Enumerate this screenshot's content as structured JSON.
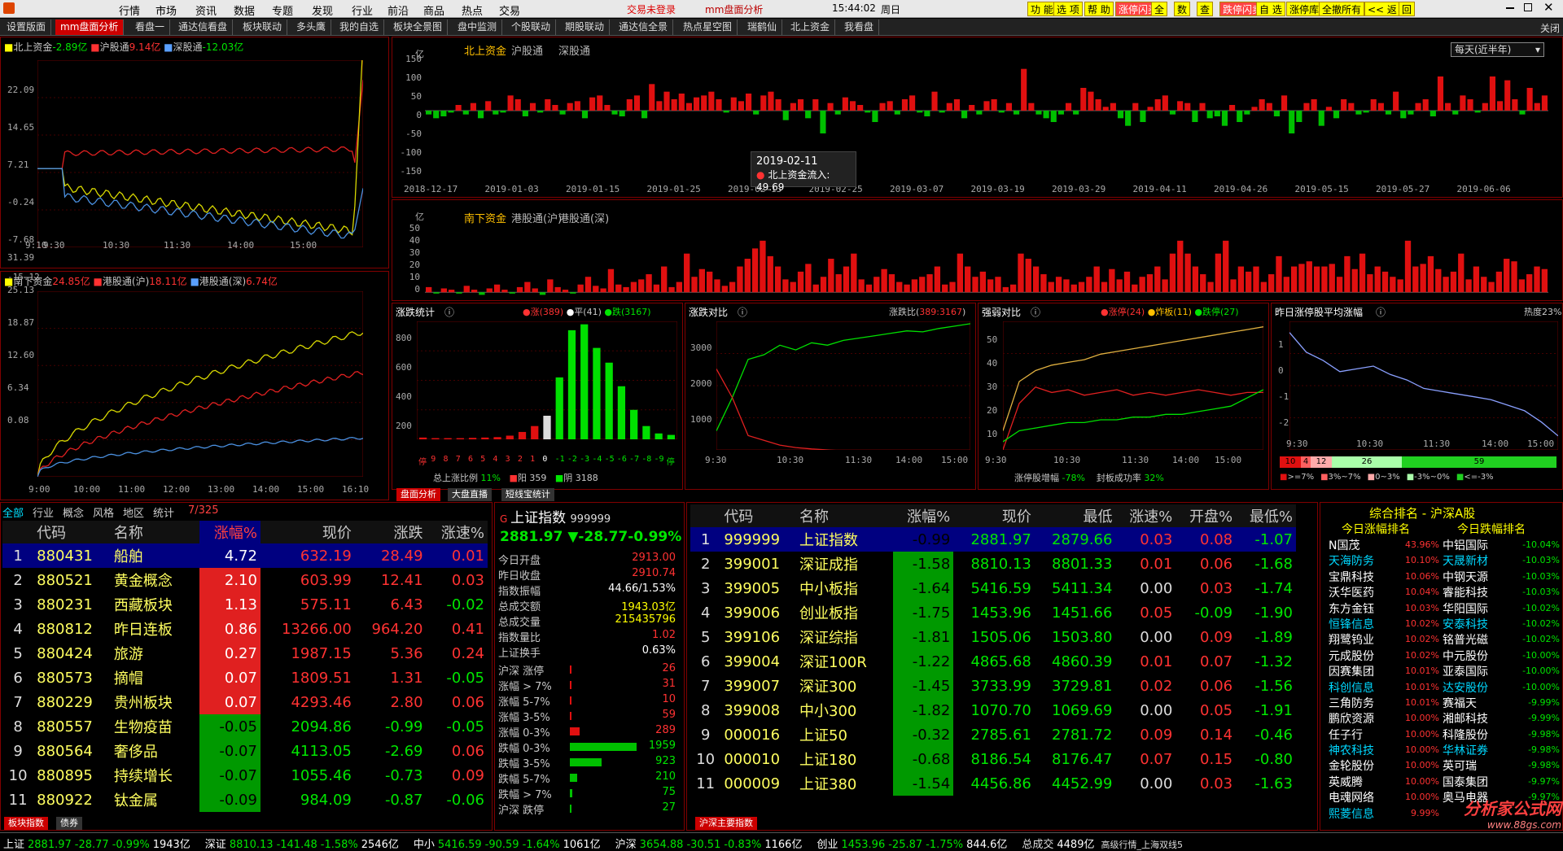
{
  "menu": {
    "items": [
      "行情",
      "市场",
      "资讯",
      "数据",
      "专题",
      "发现",
      "行业",
      "前沿",
      "商品",
      "热点",
      "交易"
    ],
    "login": "交易未登录",
    "title": "mm盘面分析",
    "quick": [
      "功 能",
      "选 项",
      "帮 助",
      "涨停闪买",
      "全",
      "数",
      "查",
      "跌停闪卖",
      "自 选",
      "涨停库",
      "全撤所有",
      "<< 返",
      "回"
    ],
    "time": "15:44:02",
    "weekday": "周日"
  },
  "tabs": [
    "设置版面",
    "mm盘面分析",
    "看盘一",
    "通达信看盘",
    "板块联动",
    "多头鹰",
    "我的自选",
    "板块全景图",
    "盘中监测",
    "个股联动",
    "期股联动",
    "通达信全景",
    "热点星空图",
    "瑞鹤仙",
    "北上资金",
    "我看盘"
  ],
  "close": "关闭",
  "north": {
    "l1": "北上资金",
    "v1": "-2.89亿",
    "l2": "沪股通",
    "v2": "9.14亿",
    "l3": "深股通",
    "v3": "-12.03亿",
    "yticks": [
      "22.09",
      "14.65",
      "7.21",
      "-0.24",
      "-7.68",
      "-15.12"
    ],
    "xticks": [
      "9:10",
      "9:30",
      "10:30",
      "11:30",
      "14:00",
      "15:00"
    ]
  },
  "south": {
    "l1": "南下资金",
    "v1": "24.85亿",
    "l2": "港股通(沪)",
    "v2": "18.11亿",
    "l3": "港股通(深)",
    "v3": "6.74亿",
    "yticks": [
      "31.39",
      "25.13",
      "18.87",
      "12.60",
      "6.34",
      "0.08"
    ],
    "xticks": [
      "9:00",
      "10:00",
      "11:00",
      "12:00",
      "13:00",
      "14:00",
      "15:00",
      "16:10"
    ]
  },
  "flowTop": {
    "unit": "亿",
    "tabs": [
      "北上资金",
      "沪股通",
      "深股通"
    ],
    "period": "每天(近半年)",
    "yticks": [
      "150",
      "100",
      "50",
      "0",
      "-50",
      "-100",
      "-150"
    ],
    "xticks": [
      "2018-12-17",
      "2019-01-03",
      "2019-01-15",
      "2019-01-25",
      "2019-02-13",
      "2019-02-25",
      "2019-03-07",
      "2019-03-19",
      "2019-03-29",
      "2019-04-11",
      "2019-04-26",
      "2019-05-15",
      "2019-05-27",
      "2019-06-06"
    ],
    "tipDate": "2019-02-11",
    "tipLabel": "北上资金流入: 49.69"
  },
  "flowBot": {
    "unit": "亿",
    "tabs": [
      "南下资金",
      "港股通(沪)",
      "港股通(深)"
    ],
    "yticks": [
      "50",
      "40",
      "30",
      "20",
      "10",
      "0"
    ]
  },
  "chart_data": [
    {
      "type": "bar",
      "title": "北上资金",
      "ylim": [
        -150,
        150
      ],
      "values": [
        -10,
        -20,
        -15,
        -5,
        15,
        -10,
        20,
        -20,
        25,
        -10,
        -5,
        40,
        30,
        -15,
        20,
        -5,
        30,
        15,
        -10,
        20,
        25,
        -20,
        35,
        40,
        15,
        -10,
        -15,
        30,
        40,
        -20,
        70,
        25,
        50,
        30,
        45,
        20,
        35,
        40,
        50,
        30,
        -5,
        35,
        25,
        45,
        -10,
        40,
        50,
        30,
        -25,
        20,
        30,
        -20,
        30,
        -60,
        20,
        -10,
        35,
        25,
        15,
        -5,
        -30,
        20,
        25,
        -10,
        30,
        40,
        -5,
        -15,
        50,
        -5,
        20,
        30,
        -20,
        15,
        -10,
        25,
        30,
        -5,
        20,
        -10,
        110,
        20,
        -10,
        -20,
        -30,
        -10,
        20,
        -10,
        60,
        50,
        30,
        10,
        20,
        -20,
        -40,
        20,
        -30,
        10,
        30,
        40,
        -10,
        25,
        20,
        -30,
        20,
        -20,
        -15,
        -40,
        15,
        -30,
        -10,
        10,
        30,
        20,
        -15,
        40,
        -60,
        -30,
        20,
        30,
        -40,
        10,
        -20,
        30,
        20,
        -10,
        -5,
        30,
        20,
        -10,
        50,
        -20,
        -10,
        20,
        30,
        -15,
        90,
        20,
        -10,
        40,
        30,
        -5,
        20,
        90,
        25,
        80,
        30,
        -10,
        60,
        20,
        40
      ]
    },
    {
      "type": "bar",
      "title": "南下资金",
      "ylim": [
        -5,
        50
      ],
      "values": [
        4,
        -1,
        3,
        2,
        -1,
        5,
        2,
        -2,
        3,
        6,
        2,
        -1,
        4,
        8,
        3,
        -2,
        10,
        4,
        2,
        -1,
        6,
        12,
        5,
        3,
        18,
        6,
        4,
        8,
        10,
        14,
        6,
        20,
        4,
        8,
        30,
        12,
        18,
        16,
        10,
        5,
        8,
        20,
        26,
        34,
        40,
        28,
        20,
        10,
        8,
        16,
        22,
        6,
        12,
        26,
        14,
        20,
        30,
        10,
        6,
        12,
        18,
        14,
        8,
        6,
        10,
        12,
        14,
        20,
        6,
        8,
        30,
        20,
        12,
        16,
        10,
        12,
        4,
        6,
        30,
        26,
        20,
        14,
        8,
        12,
        10,
        6,
        8,
        12,
        20,
        8,
        18,
        10,
        16,
        6,
        12,
        14,
        20,
        10,
        30,
        40,
        30,
        20,
        14,
        8,
        30,
        40,
        10,
        20,
        16,
        20,
        8,
        14,
        28,
        12,
        20,
        22,
        24,
        20,
        20,
        22,
        12,
        28,
        18,
        30,
        14,
        20,
        16,
        12,
        10,
        40,
        20,
        22,
        28,
        18,
        12,
        16,
        30,
        10,
        20,
        12,
        8,
        16,
        26,
        24,
        10,
        14,
        20,
        18
      ]
    },
    {
      "type": "bar",
      "title": "涨跌统计",
      "categories": [
        "停",
        "9",
        "8",
        "7",
        "6",
        "5",
        "4",
        "3",
        "2",
        "1",
        "0",
        "-1",
        "-2",
        "-3",
        "-4",
        "-5",
        "-6",
        "-7",
        "-8",
        "-9",
        "停"
      ],
      "values": [
        12,
        8,
        8,
        8,
        10,
        12,
        15,
        25,
        50,
        90,
        160,
        420,
        740,
        780,
        620,
        520,
        360,
        200,
        90,
        40,
        30
      ],
      "ylim": [
        0,
        800
      ]
    },
    {
      "type": "line",
      "title": "涨跌对比",
      "ylim": [
        500,
        3200
      ],
      "series": [
        {
          "name": "涨",
          "values": [
            900,
            1600,
            2400,
            2500,
            2700,
            2600,
            2750,
            2700,
            2800,
            2850,
            2900,
            2950,
            3000,
            2980,
            3050,
            3100,
            3150
          ]
        },
        {
          "name": "跌",
          "values": [
            2200,
            1600,
            800,
            700,
            600,
            550,
            520,
            500,
            480,
            460,
            440,
            420,
            400,
            380,
            360,
            350,
            340
          ]
        }
      ]
    },
    {
      "type": "line",
      "title": "强弱对比",
      "ylim": [
        5,
        52
      ],
      "series": [
        {
          "name": "涨停",
          "values": [
            12,
            30,
            34,
            36,
            37,
            38,
            40,
            41,
            42,
            43,
            44,
            45,
            46,
            47,
            48,
            49,
            50
          ]
        },
        {
          "name": "炸板",
          "values": [
            5,
            22,
            28,
            26,
            27,
            25,
            26,
            27,
            25,
            26,
            25,
            26,
            27,
            26,
            25,
            26,
            26
          ]
        },
        {
          "name": "跌停",
          "values": [
            8,
            12,
            13,
            14,
            15,
            15,
            16,
            16,
            17,
            17,
            18,
            18,
            19,
            20,
            21,
            24,
            27
          ]
        }
      ]
    },
    {
      "type": "line",
      "title": "昨日涨停股平均涨幅",
      "ylim": [
        -3,
        1.6
      ],
      "series": [
        {
          "name": "平均涨幅",
          "values": [
            1.2,
            0.5,
            0.2,
            -0.2,
            -0.1,
            0.0,
            -0.3,
            -0.5,
            -0.8,
            -0.9,
            -1.0,
            -1.1,
            -1.2,
            -1.4,
            -1.6,
            -2.0,
            -2.5
          ]
        }
      ]
    }
  ],
  "distStats": {
    "title": "涨跌统计",
    "up": "涨(389)",
    "flat": "平(41)",
    "down": "跌(3167)",
    "xcats": [
      "停",
      "9",
      "8",
      "7",
      "6",
      "5",
      "4",
      "3",
      "2",
      "1",
      "0",
      "-1",
      "-2",
      "-3",
      "-4",
      "-5",
      "-6",
      "-7",
      "-8",
      "-9",
      "停"
    ],
    "yticks": [
      "800",
      "600",
      "400",
      "200"
    ],
    "ratioLabel": "总上涨比例",
    "ratio": "11%",
    "sunLabel": "阳 359",
    "shadeLabel": "阴 3188"
  },
  "cmpStats": {
    "title": "涨跌对比",
    "ratioLabel": "涨跌比",
    "ratio": "389:3167",
    "yticks": [
      "3000",
      "2000",
      "1000"
    ],
    "xticks": [
      "9:30",
      "10:30",
      "11:30",
      "14:00",
      "15:00"
    ]
  },
  "strength": {
    "title": "强弱对比",
    "zt": "涨停(24)",
    "zb": "炸板(11)",
    "dt": "跌停(27)",
    "yticks": [
      "50",
      "40",
      "30",
      "20",
      "10"
    ],
    "xticks": [
      "9:30",
      "10:30",
      "11:30",
      "14:00",
      "15:00"
    ],
    "growLabel": "涨停股增幅",
    "grow": "-78%",
    "sealLabel": "封板成功率",
    "seal": "32%"
  },
  "yesterday": {
    "title": "昨日涨停股平均涨幅",
    "heat": "热度23%",
    "yticks": [
      "1",
      "0",
      "-1",
      "-2"
    ],
    "xticks": [
      "9:30",
      "10:30",
      "11:30",
      "14:00",
      "15:00"
    ],
    "bins": [
      "10",
      "4",
      "12",
      "26",
      "59"
    ],
    "legend": [
      ">=7%",
      "3%~7%",
      "0~3%",
      "-3%~0%",
      "<=-3%"
    ]
  },
  "midTabs": [
    "盘面分析",
    "大盘直播",
    "短线宝统计"
  ],
  "sector": {
    "tabs": [
      "全部",
      "行业",
      "概念",
      "风格",
      "地区",
      "统计"
    ],
    "page": "7/325",
    "headers": [
      "",
      "代码",
      "名称",
      "",
      "涨幅%",
      "现价",
      "涨跌",
      "涨速%"
    ],
    "rows": [
      [
        "1",
        "880431",
        "船舶",
        "4.72",
        "632.19",
        "28.49",
        "0.01"
      ],
      [
        "2",
        "880521",
        "黄金概念",
        "2.10",
        "603.99",
        "12.41",
        "0.03"
      ],
      [
        "3",
        "880231",
        "西藏板块",
        "1.13",
        "575.11",
        "6.43",
        "-0.02"
      ],
      [
        "4",
        "880812",
        "昨日连板",
        "0.86",
        "13266.00",
        "964.20",
        "0.41"
      ],
      [
        "5",
        "880424",
        "旅游",
        "0.27",
        "1987.15",
        "5.36",
        "0.24"
      ],
      [
        "6",
        "880573",
        "摘帽",
        "0.07",
        "1809.51",
        "1.31",
        "-0.05"
      ],
      [
        "7",
        "880229",
        "贵州板块",
        "0.07",
        "4293.46",
        "2.80",
        "0.06"
      ],
      [
        "8",
        "880557",
        "生物疫苗",
        "-0.05",
        "2094.86",
        "-0.99",
        "-0.05"
      ],
      [
        "9",
        "880564",
        "奢侈品",
        "-0.07",
        "4113.05",
        "-2.69",
        "0.06"
      ],
      [
        "10",
        "880895",
        "持续增长",
        "-0.07",
        "1055.46",
        "-0.73",
        "0.09"
      ],
      [
        "11",
        "880922",
        "钛金属",
        "-0.09",
        "984.09",
        "-0.87",
        "-0.06"
      ]
    ],
    "bottomTabs": [
      "板块指数",
      "债券"
    ]
  },
  "idx": {
    "name": "上证指数",
    "code": "999999",
    "price": "2881.97",
    "chg": "▼-28.77",
    "pct": "-0.99%",
    "info": [
      [
        "今日开盘",
        "2913.00"
      ],
      [
        "昨日收盘",
        "2910.74"
      ],
      [
        "指数振幅",
        "44.66/1.53%"
      ],
      [
        "总成交额",
        "1943.03亿"
      ],
      [
        "总成交量",
        "215435796"
      ],
      [
        "指数量比",
        "1.02"
      ],
      [
        "上证换手",
        "0.63%"
      ]
    ],
    "dist": [
      [
        "沪深 涨停",
        "26"
      ],
      [
        "涨幅 > 7%",
        "31"
      ],
      [
        "涨幅 5-7%",
        "10"
      ],
      [
        "涨幅 3-5%",
        "59"
      ],
      [
        "涨幅 0-3%",
        "289"
      ],
      [
        "跌幅 0-3%",
        "1959"
      ],
      [
        "跌幅 3-5%",
        "923"
      ],
      [
        "跌幅 5-7%",
        "210"
      ],
      [
        "跌幅 > 7%",
        "75"
      ],
      [
        "沪深 跌停",
        "27"
      ]
    ]
  },
  "indices": {
    "headers": [
      "",
      "代码",
      "名称",
      "",
      "涨幅%",
      "现价",
      "最低",
      "涨速%",
      "开盘%",
      "最低%"
    ],
    "rows": [
      [
        "1",
        "999999",
        "上证指数",
        "-0.99",
        "2881.97",
        "2879.66",
        "0.03",
        "0.08",
        "-1.07"
      ],
      [
        "2",
        "399001",
        "深证成指",
        "-1.58",
        "8810.13",
        "8801.33",
        "0.01",
        "0.06",
        "-1.68"
      ],
      [
        "3",
        "399005",
        "中小板指",
        "-1.64",
        "5416.59",
        "5411.34",
        "0.00",
        "0.03",
        "-1.74"
      ],
      [
        "4",
        "399006",
        "创业板指",
        "-1.75",
        "1453.96",
        "1451.66",
        "0.05",
        "-0.09",
        "-1.90"
      ],
      [
        "5",
        "399106",
        "深证综指",
        "-1.81",
        "1505.06",
        "1503.80",
        "0.00",
        "0.09",
        "-1.89"
      ],
      [
        "6",
        "399004",
        "深证100R",
        "-1.22",
        "4865.68",
        "4860.39",
        "0.01",
        "0.07",
        "-1.32"
      ],
      [
        "7",
        "399007",
        "深证300",
        "-1.45",
        "3733.99",
        "3729.81",
        "0.02",
        "0.06",
        "-1.56"
      ],
      [
        "8",
        "399008",
        "中小300",
        "-1.82",
        "1070.70",
        "1069.69",
        "0.00",
        "0.05",
        "-1.91"
      ],
      [
        "9",
        "000016",
        "上证50",
        "-0.32",
        "2785.61",
        "2781.72",
        "0.09",
        "0.14",
        "-0.46"
      ],
      [
        "10",
        "000010",
        "上证180",
        "-0.68",
        "8186.54",
        "8176.47",
        "0.07",
        "0.15",
        "-0.80"
      ],
      [
        "11",
        "000009",
        "上证380",
        "-1.54",
        "4456.86",
        "4452.99",
        "0.00",
        "0.03",
        "-1.63"
      ]
    ],
    "bottomTab": "沪深主要指数"
  },
  "rank": {
    "title": "综合排名 - 沪深A股",
    "upTitle": "今日涨幅排名",
    "downTitle": "今日跌幅排名",
    "up": [
      [
        "N国茂",
        "43.96%"
      ],
      [
        "天海防务",
        "10.10%"
      ],
      [
        "宝鼎科技",
        "10.06%"
      ],
      [
        "沃华医药",
        "10.04%"
      ],
      [
        "东方金钰",
        "10.03%"
      ],
      [
        "恒锋信息",
        "10.02%"
      ],
      [
        "翔鹭钨业",
        "10.02%"
      ],
      [
        "元成股份",
        "10.02%"
      ],
      [
        "因赛集团",
        "10.01%"
      ],
      [
        "科创信息",
        "10.01%"
      ],
      [
        "三角防务",
        "10.01%"
      ],
      [
        "鹏欣资源",
        "10.00%"
      ],
      [
        "任子行",
        "10.00%"
      ],
      [
        "神农科技",
        "10.00%"
      ],
      [
        "金轮股份",
        "10.00%"
      ],
      [
        "英威腾",
        "10.00%"
      ],
      [
        "电魂网络",
        "10.00%"
      ],
      [
        "熙菱信息",
        "9.99%"
      ]
    ],
    "down": [
      [
        "中铝国际",
        "-10.04%"
      ],
      [
        "天晟新材",
        "-10.03%"
      ],
      [
        "中钢天源",
        "-10.03%"
      ],
      [
        "睿能科技",
        "-10.03%"
      ],
      [
        "华阳国际",
        "-10.02%"
      ],
      [
        "安泰科技",
        "-10.02%"
      ],
      [
        "铭普光磁",
        "-10.02%"
      ],
      [
        "中元股份",
        "-10.00%"
      ],
      [
        "亚泰国际",
        "-10.00%"
      ],
      [
        "达安股份",
        "-10.00%"
      ],
      [
        "赛福天",
        "-9.99%"
      ],
      [
        "湘邮科技",
        "-9.99%"
      ],
      [
        "科隆股份",
        "-9.98%"
      ],
      [
        "华林证券",
        "-9.98%"
      ],
      [
        "英可瑞",
        "-9.98%"
      ],
      [
        "国泰集团",
        "-9.97%"
      ],
      [
        "奥马电器",
        "-9.97%"
      ]
    ]
  },
  "status": [
    [
      "上证",
      "2881.97",
      "-28.77",
      "-0.99%",
      "1943亿"
    ],
    [
      "深证",
      "8810.13",
      "-141.48",
      "-1.58%",
      "2546亿"
    ],
    [
      "中小",
      "5416.59",
      "-90.59",
      "-1.64%",
      "1061亿"
    ],
    [
      "沪深",
      "3654.88",
      "-30.51",
      "-0.83%",
      "1166亿"
    ],
    [
      "创业",
      "1453.96",
      "-25.87",
      "-1.75%",
      "844.6亿"
    ]
  ],
  "statusTail": {
    "label": "总成交",
    "value": "4489亿",
    "server": "高级行情_上海双线5"
  },
  "watermark": {
    "name": "分析家公式网",
    "url": "www.88gs.com"
  }
}
